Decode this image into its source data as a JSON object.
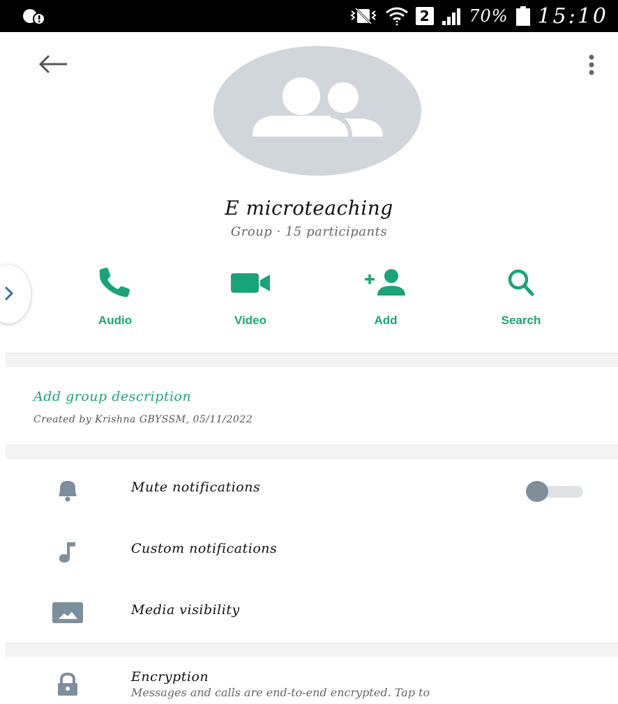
{
  "status_bar": {
    "battery": "70%",
    "sim_slot": "2",
    "time": "15:10"
  },
  "group": {
    "name": "E microteaching",
    "subtitle": "Group · 15 participants"
  },
  "actions": [
    {
      "label": "Audio",
      "icon": "phone-icon"
    },
    {
      "label": "Video",
      "icon": "video-camera-icon"
    },
    {
      "label": "Add",
      "icon": "add-person-icon"
    },
    {
      "label": "Search",
      "icon": "search-icon"
    }
  ],
  "description": {
    "link": "Add group description",
    "created": "Created by Krishna GBYSSM, 05/11/2022"
  },
  "settings": [
    {
      "label": "Mute notifications",
      "icon": "bell-icon",
      "toggle": false
    },
    {
      "label": "Custom notifications",
      "icon": "music-note-icon"
    },
    {
      "label": "Media visibility",
      "icon": "image-icon"
    }
  ],
  "encryption": {
    "title": "Encryption",
    "subtitle": "Messages and calls are end-to-end encrypted. Tap to"
  },
  "colors": {
    "accent": "#1aa37a",
    "icon_gray": "#7d8f9d",
    "avatar_bg": "#d0d6db"
  }
}
